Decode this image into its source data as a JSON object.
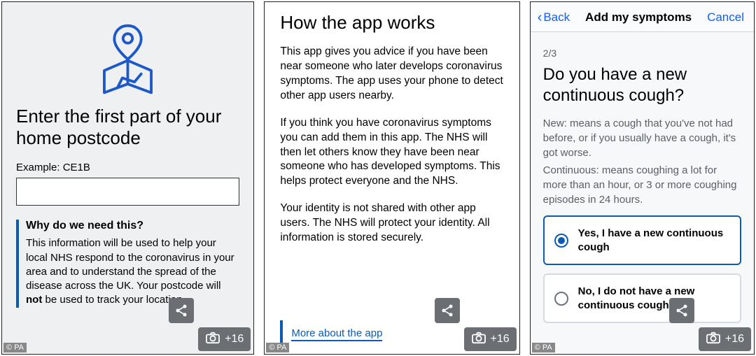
{
  "overlay": {
    "credit": "© PA",
    "gallery_count": "+16"
  },
  "screen1": {
    "heading": "Enter the first part of your home postcode",
    "example_label": "Example: CE1B",
    "postcode_value": "",
    "info_title": "Why do we need this?",
    "info_text_pre": "This information will be used to help your local NHS respond to the coronavirus in your area and to understand the spread of the disease across the UK. Your postcode will ",
    "info_text_bold": "not",
    "info_text_post": " be used to track your location."
  },
  "screen2": {
    "heading": "How the app works",
    "para1": "This app gives you advice if you have been near someone who later develops coronavirus symptoms. The app uses your phone to detect other app users nearby.",
    "para2": "If you think you have coronavirus symptoms you can add them in this app. The NHS will then let others know they have been near someone who has developed symptoms.  This helps protect everyone and the NHS.",
    "para3": "Your identity is not shared with other app users. The NHS will protect your identity. All information is stored securely.",
    "more_link": "More about the app"
  },
  "screen3": {
    "nav_back": "Back",
    "nav_title": "Add my symptoms",
    "nav_cancel": "Cancel",
    "progress": "2/3",
    "question": "Do you have a new continuous cough?",
    "def_new": "New: means a cough that you've not had before, or if you usually have a cough, it's got worse.",
    "def_cont": "Continuous: means coughing a lot for more than an hour, or 3 or more coughing episodes in 24 hours.",
    "option_yes": "Yes, I have a new continuous cough",
    "option_no": "No, I do not have a new continuous cough"
  }
}
